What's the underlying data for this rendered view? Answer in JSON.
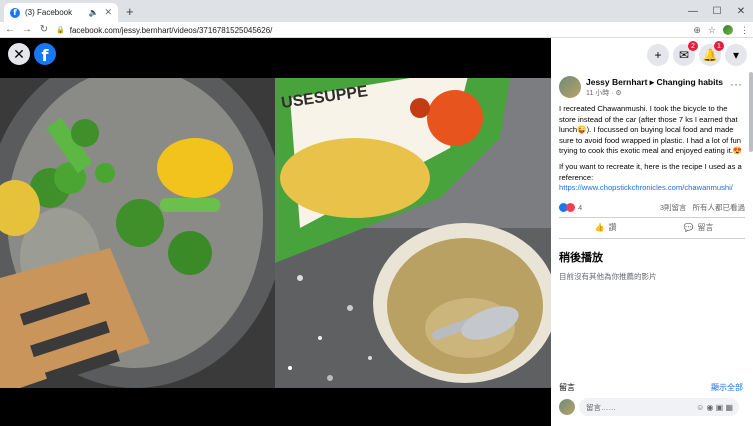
{
  "browser": {
    "tab_title": "(3) Facebook",
    "tab_favicon": "f",
    "speaker_icon": "🔈",
    "tab_close": "✕",
    "new_tab": "+",
    "win_min": "—",
    "win_max": "☐",
    "win_close": "✕",
    "back": "←",
    "forward": "→",
    "reload": "↻",
    "lock_icon": "🔒",
    "url": "facebook.com/jessy.bernhart/videos/3716781525045626/",
    "zoom_icon": "⊕",
    "star_icon": "☆",
    "menu_icon": "⋮"
  },
  "viewer": {
    "close_icon": "✕",
    "fb_logo": "f",
    "soup_box_text": "USESUPPE"
  },
  "header_icons": {
    "create": "+",
    "messenger": "✉",
    "messenger_badge": "2",
    "notifications": "🔔",
    "notifications_badge": "1",
    "account": "▾"
  },
  "post": {
    "author": "Jessy Bernhart",
    "arrow": "▸",
    "group": "Changing habits",
    "time": "11 小時 · ⚙",
    "more": "···",
    "para1": "I recreated Chawanmushi. I took the bicycle to the store instead of the car (after those 7 ks I earned that lunch😜). I focussed on buying local food and made sure to avoid food wrapped in plastic. I had a lot of fun trying to cook this exotic meal and enjoyed eating it.😍",
    "para2": "If you want to recreate it, here is the recipe I used as a reference:",
    "link": "https://www.chopstickchronicles.com/chawanmushi/",
    "reaction_count": "4",
    "comment_count": "3則留言",
    "viewers": "所有人都已看過",
    "like_label": "讚",
    "comment_label": "留言",
    "like_icon": "👍",
    "comment_icon": "💬"
  },
  "watch_later": {
    "title": "稍後播放",
    "empty_text": "目前沒有其他為你推薦的影片"
  },
  "comments": {
    "label": "留言",
    "see_all": "顯示全部",
    "placeholder": "留言……",
    "icons": "☺ ◉ ▣ ▦"
  },
  "colors": {
    "facebook_blue": "#1877f2",
    "badge_red": "#e41e3f",
    "link_blue": "#216fdb"
  }
}
